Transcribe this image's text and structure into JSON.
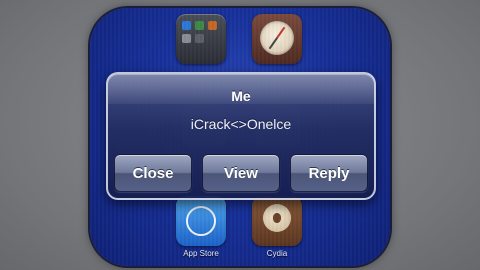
{
  "homescreen": {
    "apps": [
      {
        "name": "folder"
      },
      {
        "name": "compass"
      },
      {
        "label": "App Store"
      },
      {
        "label": "Cydia"
      }
    ]
  },
  "alert": {
    "title": "Me",
    "message": "iCrack<>Onelce",
    "buttons": {
      "close": "Close",
      "view": "View",
      "reply": "Reply"
    }
  },
  "colors": {
    "wallpaper": "#17309a",
    "background": "#7a7c80",
    "alert_border": "#e1e6f5"
  },
  "icons": [
    "folder-icon",
    "compass-icon",
    "app-store-icon",
    "cydia-icon"
  ]
}
